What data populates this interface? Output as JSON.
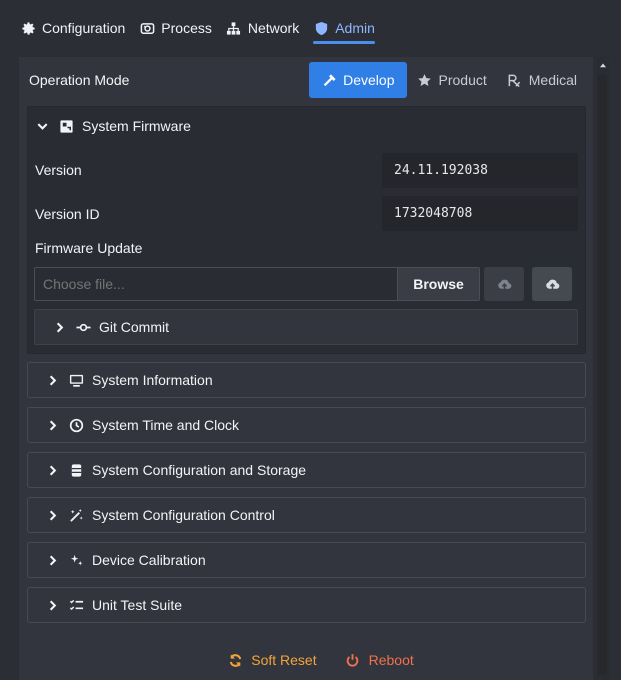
{
  "tabs": [
    {
      "label": "Configuration",
      "icon": "gear-icon"
    },
    {
      "label": "Process",
      "icon": "process-icon"
    },
    {
      "label": "Network",
      "icon": "network-icon"
    },
    {
      "label": "Admin",
      "icon": "shield-icon",
      "active": true
    }
  ],
  "operation_mode": {
    "label": "Operation Mode",
    "modes": [
      {
        "label": "Develop",
        "icon": "hammer-icon",
        "active": true
      },
      {
        "label": "Product",
        "icon": "star-icon"
      },
      {
        "label": "Medical",
        "icon": "prescription-icon"
      }
    ]
  },
  "firmware": {
    "title": "System Firmware",
    "version_label": "Version",
    "version_value": "24.11.192038",
    "version_id_label": "Version ID",
    "version_id_value": "1732048708",
    "update_label": "Firmware Update",
    "file_placeholder": "Choose file...",
    "browse_label": "Browse",
    "git_commit_label": "Git Commit"
  },
  "sections": [
    {
      "label": "System Information",
      "icon": "monitor-icon"
    },
    {
      "label": "System Time and Clock",
      "icon": "clock-icon"
    },
    {
      "label": "System Configuration and Storage",
      "icon": "database-icon"
    },
    {
      "label": "System Configuration Control",
      "icon": "magic-wand-icon"
    },
    {
      "label": "Device Calibration",
      "icon": "sparkles-icon"
    },
    {
      "label": "Unit Test Suite",
      "icon": "checklist-icon"
    }
  ],
  "actions": {
    "soft_reset_label": "Soft Reset",
    "reboot_label": "Reboot"
  },
  "colors": {
    "accent": "#2f7fe6",
    "active_tab": "#8eb6ff",
    "soft_reset": "#f2a43a",
    "reboot": "#f0714a"
  }
}
